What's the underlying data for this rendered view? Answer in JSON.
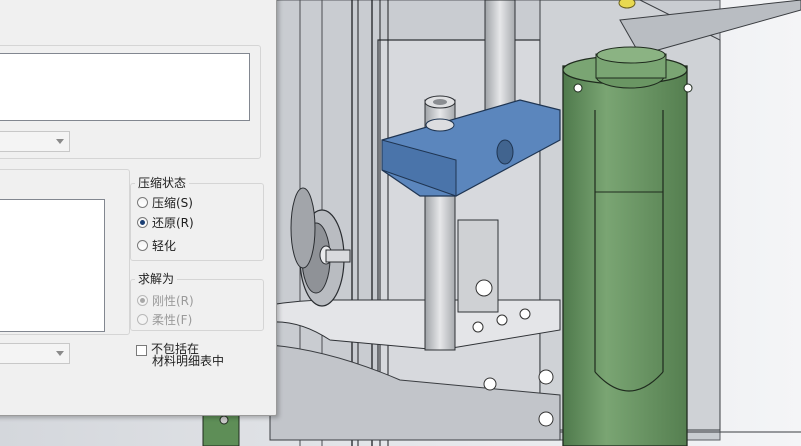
{
  "compression_group": {
    "title": "压缩状态",
    "options": [
      {
        "label": "压缩(S)",
        "checked": false,
        "enabled": true
      },
      {
        "label": "还原(R)",
        "checked": true,
        "enabled": true
      },
      {
        "label": "轻化",
        "checked": false,
        "enabled": true
      }
    ]
  },
  "solve_group": {
    "title": "求解为",
    "options": [
      {
        "label": "刚性(R)",
        "checked": true,
        "enabled": false
      },
      {
        "label": "柔性(F)",
        "checked": false,
        "enabled": false
      }
    ]
  },
  "exclude_bom": {
    "line1": "不包括在",
    "line2": "材料明细表中",
    "checked": false
  },
  "colors": {
    "cylinder": "#6f9a68",
    "bracket_selected": "#5b86bd",
    "dialog_bg": "#f0f0f0"
  }
}
